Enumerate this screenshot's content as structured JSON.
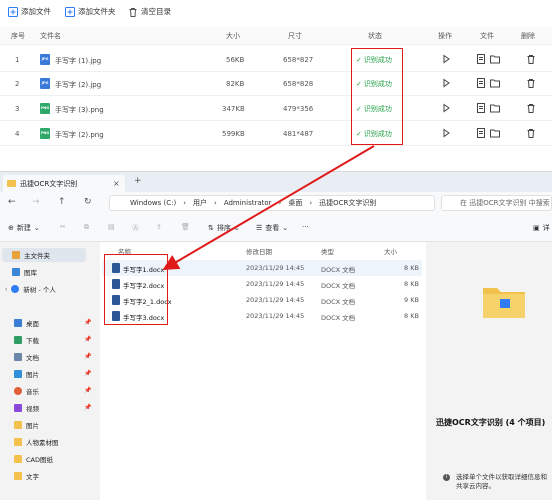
{
  "ocr_app": {
    "toolbar": {
      "add_file": "添加文件",
      "add_folder": "添加文件夹",
      "clear_list": "清空目录"
    },
    "columns": {
      "index": "序号",
      "filename": "文件名",
      "size": "大小",
      "dimensions": "尺寸",
      "status": "状态",
      "action": "操作",
      "file": "文件",
      "delete": "删除"
    },
    "rows": [
      {
        "index": "1",
        "name": "手写字 (1).jpg",
        "type": "JPG",
        "size": "56KB",
        "dims": "658*827",
        "status": "识别成功"
      },
      {
        "index": "2",
        "name": "手写字 (2).jpg",
        "type": "JPG",
        "size": "82KB",
        "dims": "658*828",
        "status": "识别成功"
      },
      {
        "index": "3",
        "name": "手写字 (3).png",
        "type": "PNG",
        "size": "347KB",
        "dims": "479*356",
        "status": "识别成功"
      },
      {
        "index": "4",
        "name": "手写字 (2).png",
        "type": "PNG",
        "size": "599KB",
        "dims": "481*487",
        "status": "识别成功"
      }
    ],
    "colors": {
      "success": "#24a148",
      "highlight": "#e01a1a"
    }
  },
  "explorer": {
    "tab_title": "迅捷OCR文字识别",
    "tab_close": "×",
    "new_tab": "+",
    "address": {
      "segments": [
        "Windows (C:)",
        "用户",
        "Administrator",
        "桌面",
        "迅捷OCR文字识别"
      ],
      "separator": "›"
    },
    "search_placeholder": "在 迅捷OCR文字识别 中搜索",
    "commands": {
      "new": "新建",
      "sort": "排序",
      "view": "查看",
      "more": "···",
      "details": "详"
    },
    "sidebar": [
      {
        "label": "主文件夹",
        "active": true
      },
      {
        "label": "图库"
      },
      {
        "label": "新树 - 个人"
      },
      {
        "label": "桌面",
        "pinned": true
      },
      {
        "label": "下载",
        "pinned": true
      },
      {
        "label": "文档",
        "pinned": true
      },
      {
        "label": "图片",
        "pinned": true
      },
      {
        "label": "音乐",
        "pinned": true
      },
      {
        "label": "视频",
        "pinned": true
      },
      {
        "label": "图片"
      },
      {
        "label": "人物素材图"
      },
      {
        "label": "CAD图纸"
      },
      {
        "label": "文字"
      }
    ],
    "file_columns": {
      "name": "名称",
      "modified": "修改日期",
      "type": "类型",
      "size": "大小"
    },
    "files": [
      {
        "name": "手写字1.docx",
        "modified": "2023/11/29 14:45",
        "type": "DOCX 文档",
        "size": "8 KB"
      },
      {
        "name": "手写字2.docx",
        "modified": "2023/11/29 14:45",
        "type": "DOCX 文档",
        "size": "8 KB"
      },
      {
        "name": "手写字2_1.docx",
        "modified": "2023/11/29 14:45",
        "type": "DOCX 文档",
        "size": "9 KB"
      },
      {
        "name": "手写字3.docx",
        "modified": "2023/11/29 14:45",
        "type": "DOCX 文档",
        "size": "8 KB"
      }
    ],
    "preview": {
      "title": "迅捷OCR文字识别 (4 个项目)",
      "hint": "选择单个文件以获取详细信息和共享云内容。"
    }
  }
}
